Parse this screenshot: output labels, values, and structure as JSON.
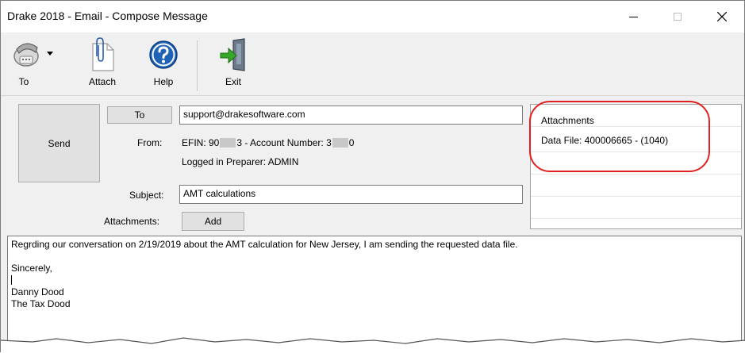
{
  "window": {
    "title": "Drake 2018 - Email - Compose Message"
  },
  "toolbar": {
    "to_label": "To",
    "attach_label": "Attach",
    "help_label": "Help",
    "exit_label": "Exit"
  },
  "compose": {
    "send_label": "Send",
    "to_button_label": "To",
    "to_value": "support@drakesoftware.com",
    "from_label": "From:",
    "from_efin_prefix": "EFIN: 90",
    "from_efin_suffix": "3 - Account Number: 3",
    "from_account_suffix": "0",
    "logged_in": "Logged in Preparer: ADMIN",
    "subject_label": "Subject:",
    "subject_value": "AMT calculations",
    "attachments_label": "Attachments:",
    "add_label": "Add"
  },
  "attachments_panel": {
    "header": "Attachments",
    "items": [
      "Data File: 400006665 - (1040)"
    ]
  },
  "message": {
    "lines": [
      "Regrding our conversation on 2/19/2019 about the AMT calculation for New Jersey, I am sending the requested data file.",
      "",
      "Sincerely,",
      "",
      "Danny Dood",
      "The Tax Dood"
    ]
  },
  "colors": {
    "highlight": "#e02020",
    "help_icon": "#1e63b5",
    "exit_arrow": "#35a828"
  },
  "icons": [
    "fax-phone-icon",
    "paperclip-icon",
    "help-icon",
    "exit-door-icon",
    "dropdown-arrow-icon",
    "minimize-icon",
    "maximize-icon",
    "close-icon"
  ]
}
